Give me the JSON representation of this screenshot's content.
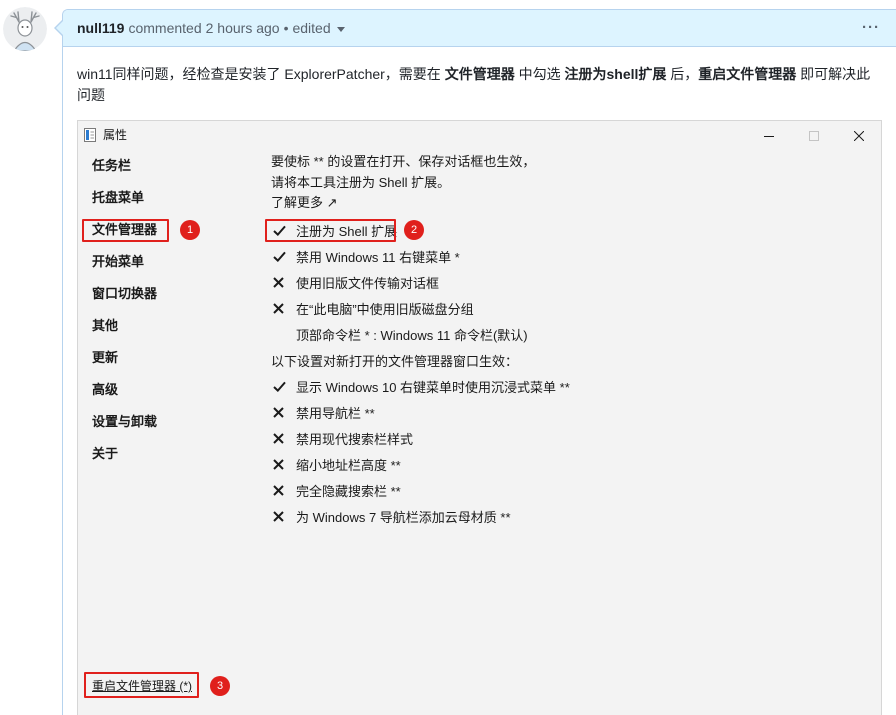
{
  "comment": {
    "avatar_icon": "deer-avatar-icon",
    "author": "null119",
    "action": "commented",
    "time": "2 hours ago",
    "separator": "•",
    "edited": "edited",
    "menu": "···",
    "body": [
      "win11同样问题，经检查是安装了 ExplorerPatcher，需要在 ",
      "文件管理器",
      " 中勾选 ",
      "注册为shell扩展",
      " 后，",
      "重启文件管理器",
      " 即可解决此问题"
    ]
  },
  "dialog": {
    "title": "属性",
    "title_icon": "properties-window-icon",
    "sidebar": [
      "任务栏",
      "托盘菜单",
      "文件管理器",
      "开始菜单",
      "窗口切换器",
      "其他",
      "更新",
      "高级",
      "设置与卸载",
      "关于"
    ],
    "restart": "重启文件管理器 (*)",
    "intro": [
      "要使标 ** 的设置在打开、保存对话框也生效，",
      "请将本工具注册为 Shell 扩展。"
    ],
    "learn_more": "了解更多 ↗",
    "options": [
      {
        "label": "注册为 Shell 扩展",
        "checked": true
      },
      {
        "label": "禁用 Windows 11 右键菜单 *",
        "checked": true
      },
      {
        "label": "使用旧版文件传输对话框",
        "checked": false
      },
      {
        "label": "在“此电脑”中使用旧版磁盘分组",
        "checked": false
      }
    ],
    "command_bar": "顶部命令栏 * : Windows 11 命令栏(默认)",
    "new_window_note": "以下设置对新打开的文件管理器窗口生效：",
    "new_window_options": [
      {
        "label": "显示 Windows 10 右键菜单时使用沉浸式菜单 **",
        "checked": true
      },
      {
        "label": "禁用导航栏 **",
        "checked": false
      },
      {
        "label": "禁用现代搜索栏样式",
        "checked": false
      },
      {
        "label": "缩小地址栏高度 **",
        "checked": false
      },
      {
        "label": "完全隐藏搜索栏 **",
        "checked": false
      },
      {
        "label": "为 Windows 7 导航栏添加云母材质 **",
        "checked": false
      }
    ]
  },
  "annotations": {
    "step1": "1",
    "step2": "2",
    "step3": "3"
  },
  "colors": {
    "header_bg": "#ddf4ff",
    "highlight": "#e0201c",
    "dialog_bg": "#f3f3f3"
  }
}
